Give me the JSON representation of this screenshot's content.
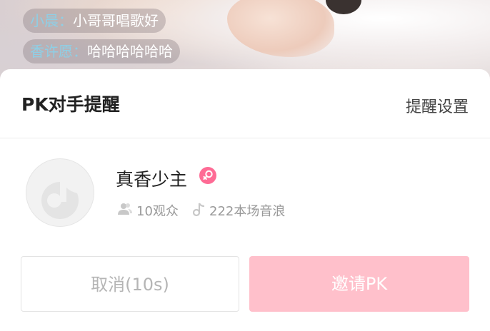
{
  "background_chat": [
    {
      "name": "小晨：",
      "message": "小哥哥唱歌好"
    },
    {
      "name": "香许愿：",
      "message": "哈哈哈哈哈哈"
    }
  ],
  "panel": {
    "title": "PK对手提醒",
    "settings_label": "提醒设置"
  },
  "opponent": {
    "name": "真香少主",
    "badge_icon": "female-gender-icon",
    "audience": "10观众",
    "waves": "222本场音浪"
  },
  "buttons": {
    "cancel_label": "取消(10s)",
    "invite_label": "邀请PK"
  },
  "colors": {
    "invite_bg": "#ffc0cb",
    "badge": "#fe6b95",
    "chat_name": "#8ecfe6"
  }
}
